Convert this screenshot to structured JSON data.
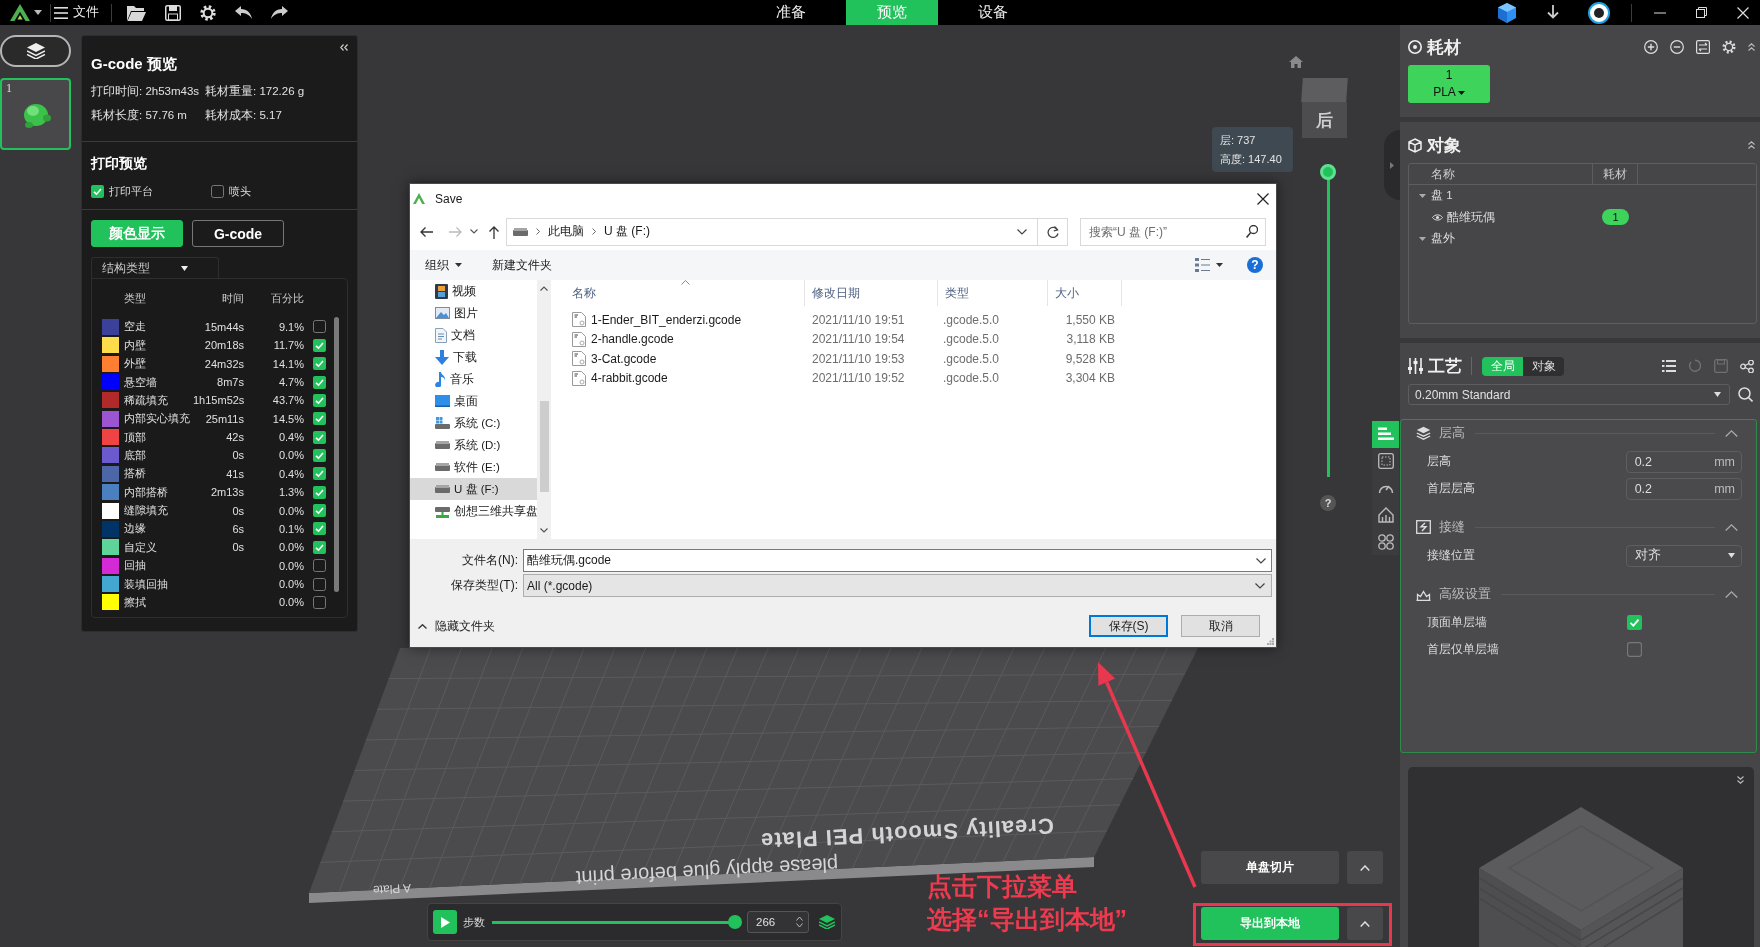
{
  "top_bar": {
    "menu": "文件",
    "mode_tabs": [
      {
        "label": "准备",
        "selected": false
      },
      {
        "label": "预览",
        "selected": true
      },
      {
        "label": "设备",
        "selected": false
      }
    ]
  },
  "plates": [
    {
      "number": "1",
      "selected": true
    }
  ],
  "gcode_panel": {
    "title": "G-code 预览",
    "stats": [
      "打印时间: 2h53m43s",
      "耗材重量: 172.26 g",
      "耗材长度: 57.76 m",
      "耗材成本: 5.17"
    ],
    "preview_title": "打印预览",
    "options": [
      {
        "label": "打印平台",
        "checked": true
      },
      {
        "label": "喷头",
        "checked": false
      }
    ],
    "view_modes": [
      {
        "label": "颜色显示",
        "selected": true
      },
      {
        "label": "G-code",
        "selected": false
      }
    ],
    "legend_type": "结构类型",
    "legend_columns": [
      "类型",
      "时间",
      "百分比"
    ],
    "legend": [
      {
        "name": "空走",
        "time": "15m44s",
        "percent": "9.1%",
        "color": "#3b4199",
        "checked": false
      },
      {
        "name": "内壁",
        "time": "20m18s",
        "percent": "11.7%",
        "color": "#fddc4a",
        "checked": true
      },
      {
        "name": "外壁",
        "time": "24m32s",
        "percent": "14.1%",
        "color": "#ff7f32",
        "checked": true
      },
      {
        "name": "悬空墙",
        "time": "8m7s",
        "percent": "4.7%",
        "color": "#0000ff",
        "checked": true
      },
      {
        "name": "稀疏填充",
        "time": "1h15m52s",
        "percent": "43.7%",
        "color": "#b02a2a",
        "checked": true
      },
      {
        "name": "内部实心填充",
        "time": "25m11s",
        "percent": "14.5%",
        "color": "#9b55d0",
        "checked": true
      },
      {
        "name": "顶部",
        "time": "42s",
        "percent": "0.4%",
        "color": "#f04444",
        "checked": true
      },
      {
        "name": "底部",
        "time": "0s",
        "percent": "0.0%",
        "color": "#6a5acd",
        "checked": true
      },
      {
        "name": "搭桥",
        "time": "41s",
        "percent": "0.4%",
        "color": "#4c66a8",
        "checked": true
      },
      {
        "name": "内部搭桥",
        "time": "2m13s",
        "percent": "1.3%",
        "color": "#4a7fc0",
        "checked": true
      },
      {
        "name": "缝隙填充",
        "time": "0s",
        "percent": "0.0%",
        "color": "#ffffff",
        "checked": true
      },
      {
        "name": "边缘",
        "time": "6s",
        "percent": "0.1%",
        "color": "#003366",
        "checked": true
      },
      {
        "name": "自定义",
        "time": "0s",
        "percent": "0.0%",
        "color": "#5ed49a",
        "checked": true
      },
      {
        "name": "回抽",
        "percent": "0.0%",
        "color": "#d42ad6",
        "checked": false
      },
      {
        "name": "装填回抽",
        "percent": "0.0%",
        "color": "#42a8d0",
        "checked": false
      },
      {
        "name": "擦拭",
        "percent": "0.0%",
        "color": "#ffff00",
        "checked": false
      }
    ]
  },
  "viewport": {
    "plate_labels": [
      "Creality Smooth PEI Plate",
      "please apply glue before print",
      "A Plate"
    ],
    "view_cube_label": "后",
    "layer_info": [
      "层: 737",
      "高度: 147.40"
    ],
    "layer_slider": {
      "level": 1
    },
    "help": "?",
    "steps": {
      "label": "步数",
      "level": 1,
      "value": "266"
    },
    "slice_button": "单盘切片",
    "export_button": "导出到本地",
    "annotation": [
      "点击下拉菜单",
      "选择“导出到本地”"
    ]
  },
  "save_dialog": {
    "title": "Save",
    "path": [
      "此电脑",
      "U 盘 (F:)"
    ],
    "search_placeholder": "搜索“U 盘 (F:)”",
    "toolbar": [
      {
        "label": "组织",
        "menu": true
      },
      {
        "label": "新建文件夹",
        "menu": false
      }
    ],
    "help": "?",
    "nav_items": [
      {
        "label": "视频",
        "kind": "video",
        "selected": false
      },
      {
        "label": "图片",
        "kind": "pictures",
        "selected": false
      },
      {
        "label": "文档",
        "kind": "documents",
        "selected": false
      },
      {
        "label": "下载",
        "kind": "downloads",
        "selected": false
      },
      {
        "label": "音乐",
        "kind": "music",
        "selected": false
      },
      {
        "label": "桌面",
        "kind": "desktop",
        "selected": false
      },
      {
        "label": "系统 (C:)",
        "kind": "system_drive",
        "selected": false
      },
      {
        "label": "系统 (D:)",
        "kind": "drive",
        "selected": false
      },
      {
        "label": "软件 (E:)",
        "kind": "drive",
        "selected": false
      },
      {
        "label": "U 盘 (F:)",
        "kind": "drive",
        "selected": true
      },
      {
        "label": "创想三维共享盘",
        "kind": "network_drive",
        "selected": false
      }
    ],
    "columns": [
      "名称",
      "修改日期",
      "类型",
      "大小"
    ],
    "files": [
      {
        "name": "1-Ender_BIT_enderzi.gcode",
        "modified": "2021/11/10 19:51",
        "type": ".gcode.5.0",
        "size": "1,550 KB"
      },
      {
        "name": "2-handle.gcode",
        "modified": "2021/11/10 19:54",
        "type": ".gcode.5.0",
        "size": "3,118 KB"
      },
      {
        "name": "3-Cat.gcode",
        "modified": "2021/11/10 19:53",
        "type": ".gcode.5.0",
        "size": "9,528 KB"
      },
      {
        "name": "4-rabbit.gcode",
        "modified": "2021/11/10 19:52",
        "type": ".gcode.5.0",
        "size": "3,304 KB"
      }
    ],
    "file_name_label": "文件名(N):",
    "file_name": "酷维玩偶.gcode",
    "file_type_label": "保存类型(T):",
    "file_type": "All (*.gcode)",
    "hide_folders": "隐藏文件夹",
    "buttons": [
      {
        "label": "保存(S)",
        "default": true
      },
      {
        "label": "取消",
        "default": false
      }
    ]
  },
  "filament_panel": {
    "title": "耗材",
    "slots": [
      {
        "number": "1",
        "material": "PLA"
      }
    ]
  },
  "objects_panel": {
    "title": "对象",
    "columns": [
      "名称",
      "耗材"
    ],
    "tree": [
      {
        "label": "盘 1",
        "expanded": true,
        "children": [
          {
            "label": "酷维玩偶",
            "filament": "1"
          }
        ]
      },
      {
        "label": "盘外",
        "expanded": true
      }
    ]
  },
  "process_panel": {
    "title": "工艺",
    "scopes": [
      {
        "label": "全局",
        "selected": true
      },
      {
        "label": "对象",
        "selected": false
      }
    ],
    "preset": "0.20mm Standard",
    "side_tabs": [
      {
        "selected": true
      },
      {
        "selected": false
      },
      {
        "selected": false
      },
      {
        "selected": false
      },
      {
        "selected": false
      }
    ],
    "sections": [
      {
        "title": "层高",
        "expanded": true,
        "settings": [
          {
            "kind": "number",
            "label": "层高",
            "value": "0.2",
            "unit": "mm"
          },
          {
            "kind": "number",
            "label": "首层层高",
            "value": "0.2",
            "unit": "mm"
          }
        ]
      },
      {
        "title": "接缝",
        "expanded": true,
        "settings": [
          {
            "kind": "select",
            "label": "接缝位置",
            "value": "对齐"
          }
        ]
      },
      {
        "title": "高级设置",
        "expanded": true,
        "settings": [
          {
            "kind": "checkbox",
            "label": "顶面单层墙",
            "checked": true
          },
          {
            "kind": "checkbox",
            "label": "首层仅单层墙",
            "checked": false
          }
        ]
      }
    ]
  }
}
